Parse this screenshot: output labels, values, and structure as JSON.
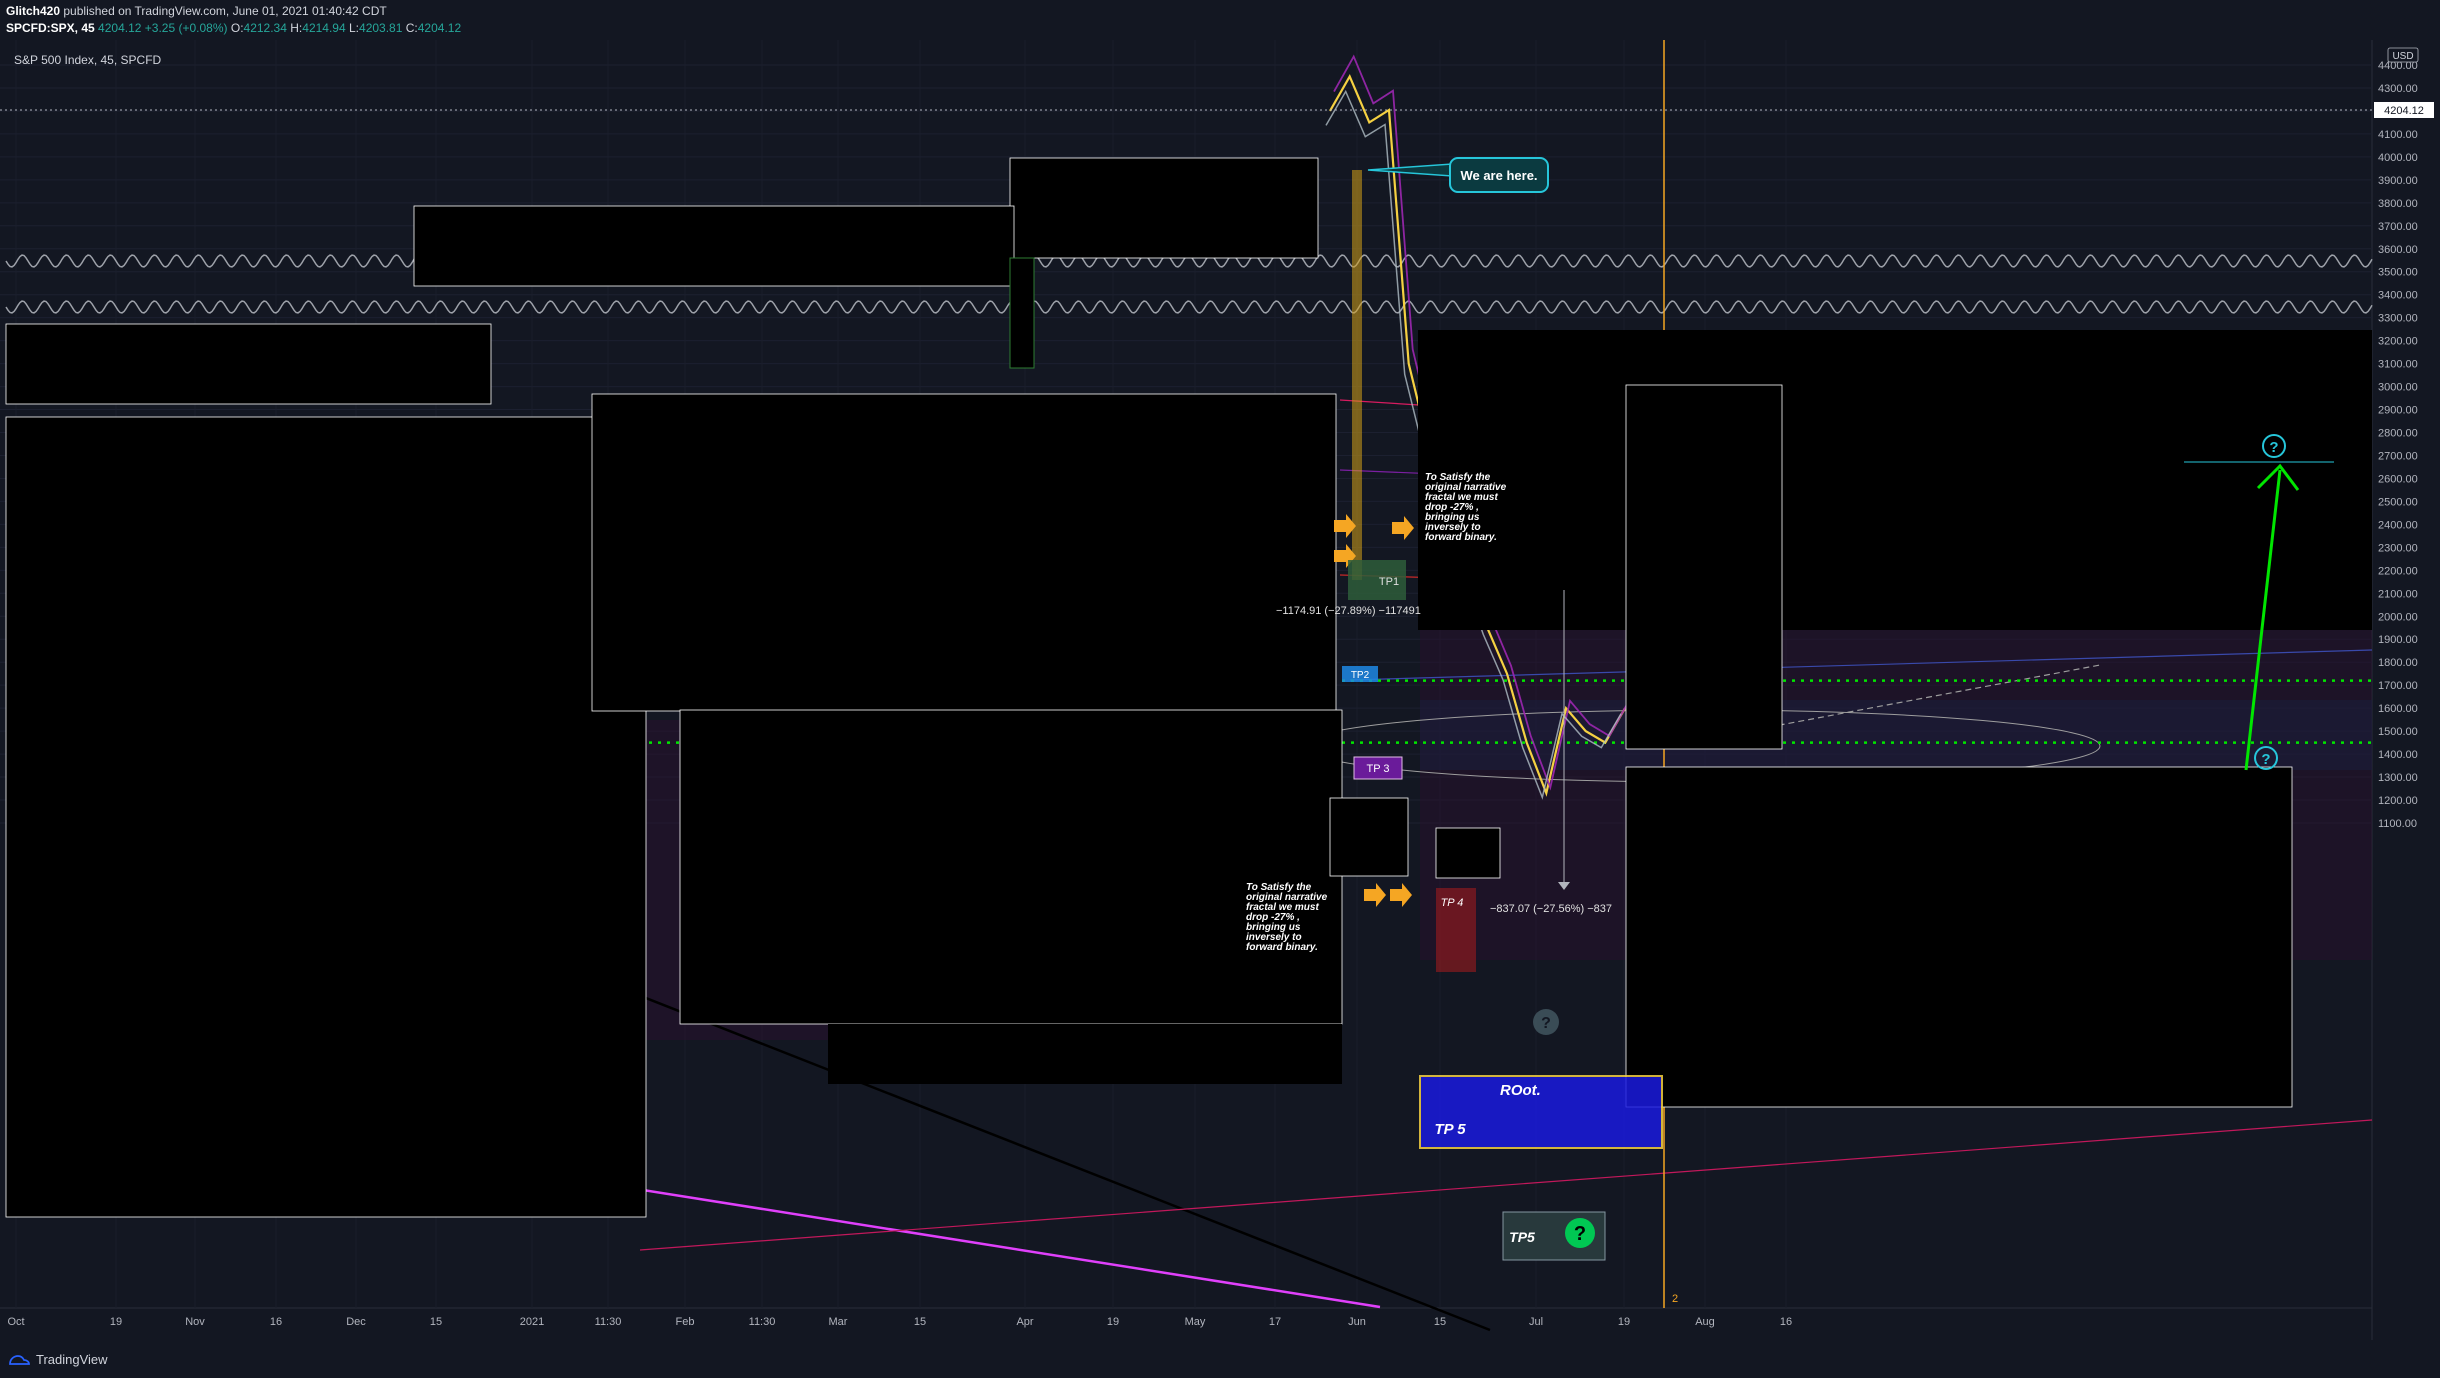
{
  "header": {
    "publisher": "Glitch420",
    "published_text": "published on TradingView.com, June 01, 2021 01:40:42 CDT",
    "symbol": "SPCFD:SPX, 45",
    "last_price": "4204.12",
    "change": "+3.25 (+0.08%)",
    "ohlc": {
      "o_label": "O:",
      "o": "4212.34",
      "h_label": "H:",
      "h": "4214.94",
      "l_label": "L:",
      "l": "4203.81",
      "c_label": "C:",
      "c": "4204.12"
    }
  },
  "chart_data": {
    "type": "line",
    "title": "S&P 500 Index, 45, SPCFD",
    "currency": "USD",
    "current_price_label": "4204.12",
    "y_ticks": [
      "4400.00",
      "4300.00",
      "4200.00",
      "4100.00",
      "4000.00",
      "3900.00",
      "3800.00",
      "3700.00",
      "3600.00",
      "3500.00",
      "3400.00",
      "3300.00",
      "3200.00",
      "3100.00",
      "3000.00",
      "2900.00",
      "2800.00",
      "2700.00",
      "2600.00",
      "2500.00",
      "2400.00",
      "2300.00",
      "2200.00",
      "2100.00",
      "2000.00",
      "1900.00",
      "1800.00",
      "1700.00",
      "1600.00",
      "1500.00",
      "1400.00",
      "1300.00",
      "1200.00",
      "1100.00"
    ],
    "x_ticks": [
      "Oct",
      "19",
      "Nov",
      "16",
      "Dec",
      "15",
      "2021",
      "11:30",
      "Feb",
      "11:30",
      "Mar",
      "15",
      "Apr",
      "19",
      "May",
      "17",
      "Jun",
      "15",
      "Jul",
      "19",
      "Aug",
      "16"
    ],
    "ylim": [
      1050,
      4450
    ],
    "grid": true,
    "annotations": {
      "we_are_here": "We are here.",
      "narrative_lines": [
        "To Satisfy the",
        "original narrative",
        "fractal we must",
        "drop -27% ,",
        "bringing us",
        "inversely to",
        "forward binary."
      ],
      "tp1": "TP1",
      "tp2": "TP2",
      "tp3": "TP 3",
      "tp4": "TP 4",
      "tp5": "TP 5",
      "tp5_low": "TP5",
      "root": "ROot.",
      "measure_1": "−1174.91 (−27.89%) −117491",
      "measure_2": "−837.07 (−27.56%) −837",
      "question_mark": "?",
      "bar_count": "2"
    },
    "series": [
      {
        "name": "",
        "x": [
          "2021-05-24",
          "2021-05-26",
          "2021-05-28",
          "2021-06-01",
          "2021-06-05",
          "2021-06-09",
          "2021-06-13",
          "2021-06-17",
          "2021-06-21",
          "2021-06-25",
          "2021-06-29",
          "2021-07-03",
          "2021-07-07",
          "2021-07-11",
          "2021-07-15",
          "2021-07-19"
        ],
        "values": [
          4200,
          4350,
          4150,
          4204,
          3100,
          2750,
          2500,
          2200,
          1950,
          1750,
          1450,
          1230,
          1600,
          1500,
          1450,
          1600
        ]
      }
    ],
    "key_levels": [
      {
        "value": 1720,
        "style": "green-dotted"
      },
      {
        "value": 1450,
        "style": "green-dotted"
      }
    ]
  },
  "footer": {
    "brand": "TradingView"
  },
  "colors": {
    "background": "#131722",
    "grid": "#1f2433",
    "axis_text": "#b2b5be",
    "price_line": "#f5d142",
    "accent_cyan": "#26c6da",
    "accent_green": "#00e600",
    "accent_purple": "#9c27b0",
    "tp_blue_box": "#1a1adf",
    "orange_vertical": "#f5a623"
  }
}
